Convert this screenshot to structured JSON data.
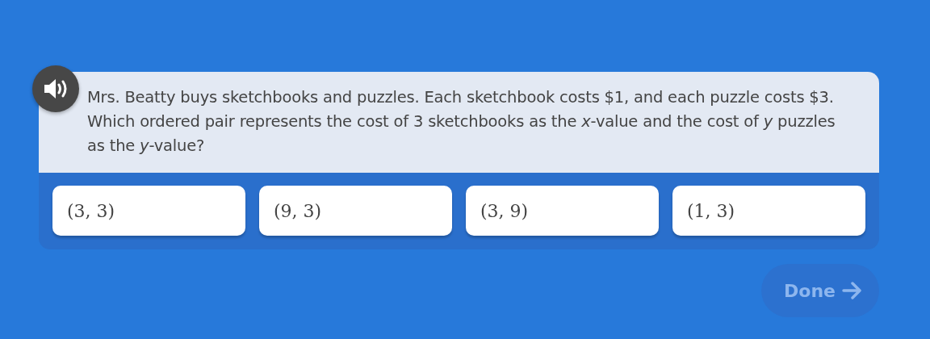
{
  "question": {
    "text": "Mrs. Beatty buys sketchbooks and puzzles. Each sketchbook costs $1, and each puzzle costs $3. Which ordered pair represents the cost of 3 sketchbooks as the *x*-value and the cost of *y* puzzles as the *y*-value?"
  },
  "answers": [
    {
      "label": "(3, 3)",
      "selected": false
    },
    {
      "label": "(9, 3)",
      "selected": false
    },
    {
      "label": "(3, 9)",
      "selected": false
    },
    {
      "label": "(1, 3)",
      "selected": false
    }
  ],
  "done_button": {
    "label": "Done",
    "disabled": true
  }
}
